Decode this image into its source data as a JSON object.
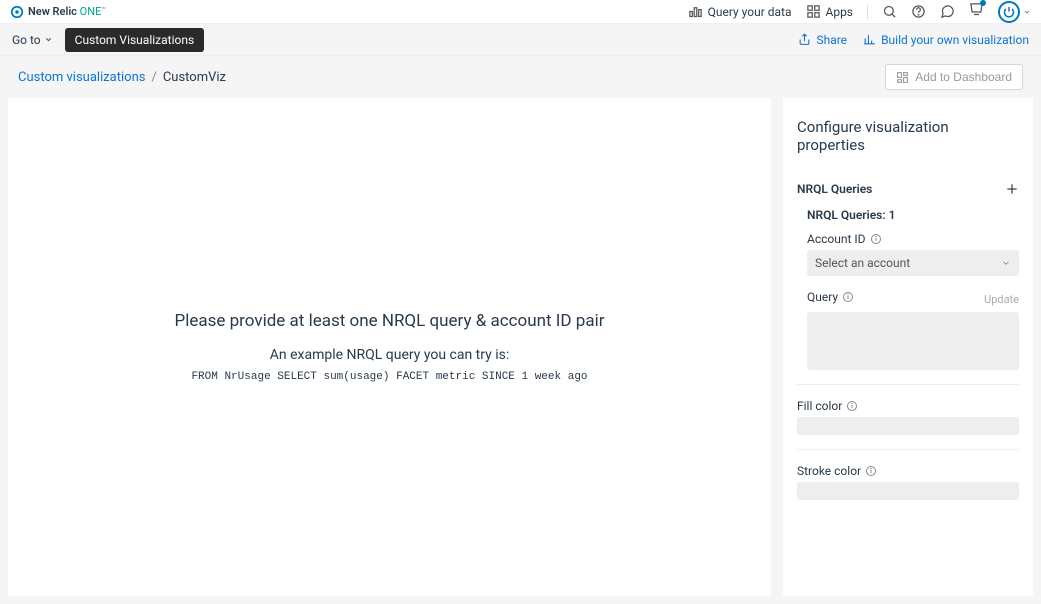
{
  "header": {
    "brand_primary": "New Relic",
    "brand_secondary": "ONE",
    "brand_tm": "™",
    "query_data": "Query your data",
    "apps": "Apps"
  },
  "subheader": {
    "goto": "Go to",
    "pill": "Custom Visualizations",
    "share": "Share",
    "build": "Build your own visualization"
  },
  "breadcrumb": {
    "root": "Custom visualizations",
    "sep": "/",
    "current": "CustomViz",
    "add_dashboard": "Add to Dashboard"
  },
  "placeholder": {
    "title": "Please provide at least one NRQL query & account ID pair",
    "subtitle": "An example NRQL query you can try is:",
    "code": "FROM NrUsage SELECT sum(usage) FACET metric SINCE 1 week ago"
  },
  "panel": {
    "title": "Configure visualization properties",
    "nrql_heading": "NRQL Queries",
    "nrql_instance": "NRQL Queries: 1",
    "account_id_label": "Account ID",
    "account_select_placeholder": "Select an account",
    "query_label": "Query",
    "update": "Update",
    "fill_color": "Fill color",
    "stroke_color": "Stroke color"
  }
}
